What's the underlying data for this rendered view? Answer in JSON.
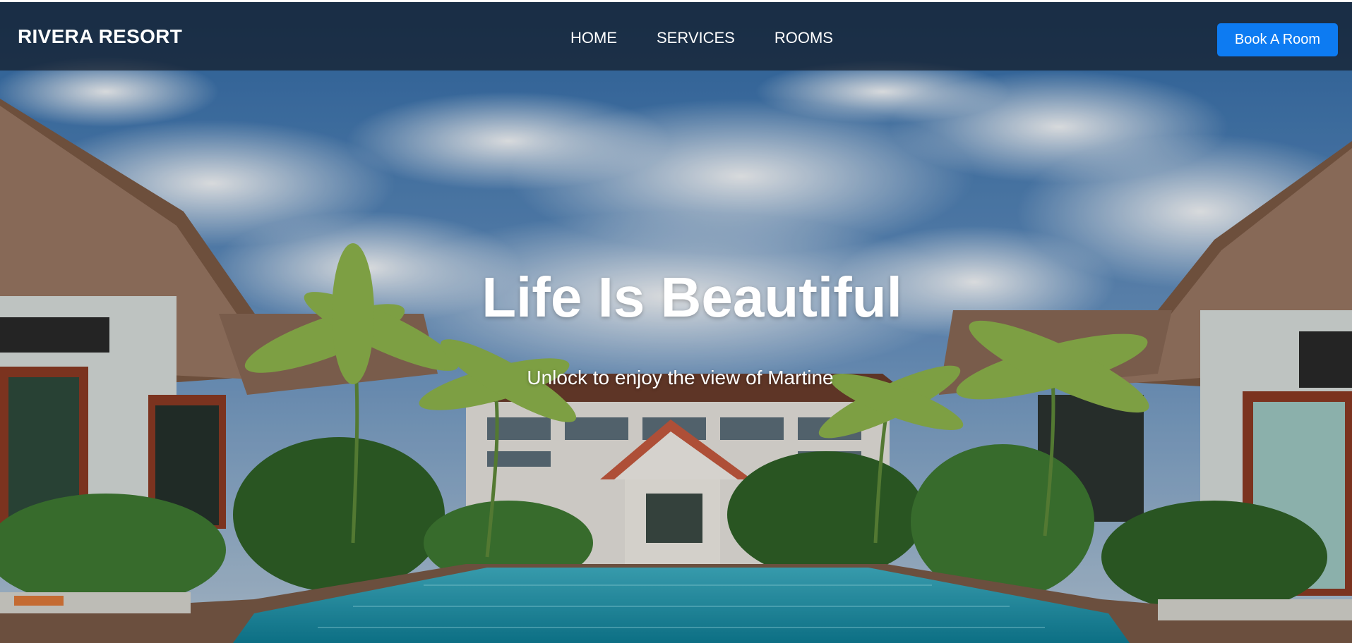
{
  "navbar": {
    "brand": "RIVERA RESORT",
    "links": [
      "HOME",
      "SERVICES",
      "ROOMS"
    ],
    "cta_label": "Book A Room"
  },
  "hero": {
    "headline": "Life Is Beautiful",
    "subheadline": "Unlock to enjoy the view of Martine"
  },
  "colors": {
    "cta_background": "#0d7bf2",
    "navbar_overlay": "rgba(20,28,40,0.72)",
    "text": "#ffffff"
  }
}
